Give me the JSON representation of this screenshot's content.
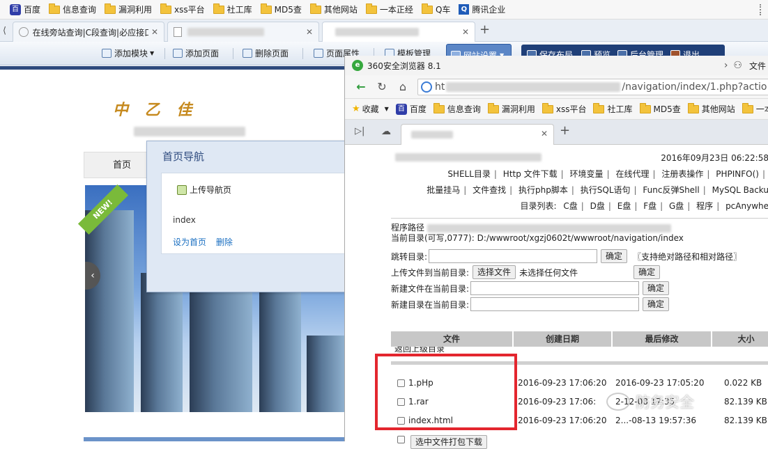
{
  "bookmarks": [
    {
      "label": "百度",
      "icon": "baidu-paw-icon"
    },
    {
      "label": "信息查询",
      "icon": "folder-icon"
    },
    {
      "label": "漏洞利用",
      "icon": "folder-icon"
    },
    {
      "label": "xss平台",
      "icon": "folder-icon"
    },
    {
      "label": "社工库",
      "icon": "folder-icon"
    },
    {
      "label": "MD5查",
      "icon": "folder-icon"
    },
    {
      "label": "其他网站",
      "icon": "folder-icon"
    },
    {
      "label": "一本正经",
      "icon": "folder-icon"
    },
    {
      "label": "Q车",
      "icon": "folder-icon"
    },
    {
      "label": "腾讯企业",
      "icon": "tencent-icon"
    }
  ],
  "outer_tabs": {
    "tab1": "在线旁站查询|C段查询|必应接口"
  },
  "toolbar": {
    "add_module": "添加模块",
    "add_page": "添加页面",
    "delete_page": "删除页面",
    "page_props": "页面属性",
    "template_mgmt": "模板管理",
    "site_settings": "网站设置",
    "save_layout": "保存布局",
    "preview": "预览",
    "backend": "后台管理",
    "logout": "退出"
  },
  "site": {
    "logo": "中 乙 佳",
    "home_menu": "首页",
    "ribbon": "NEW!",
    "prev_arrow": "‹"
  },
  "dialog": {
    "title": "首页导航",
    "upload_link": "上传导航页",
    "item": "index",
    "set_home": "设为首页",
    "delete": "删除"
  },
  "inner_browser": {
    "title": "360安全浏览器 8.1",
    "file_menu": "文件",
    "url_prefix": "ht",
    "url_suffix": "/navigation/index/1.php?actio",
    "bookmarks": [
      {
        "label": "收藏",
        "icon": "star-icon"
      },
      {
        "label": "百度",
        "icon": "baidu-paw-icon"
      },
      {
        "label": "信息查询",
        "icon": "folder-icon"
      },
      {
        "label": "漏洞利用",
        "icon": "folder-icon"
      },
      {
        "label": "xss平台",
        "icon": "folder-icon"
      },
      {
        "label": "社工库",
        "icon": "folder-icon"
      },
      {
        "label": "MD5查",
        "icon": "folder-icon"
      },
      {
        "label": "其他网站",
        "icon": "folder-icon"
      },
      {
        "label": "一本正",
        "icon": "folder-icon"
      }
    ]
  },
  "shell": {
    "datetime": "2016年09月23日 06:22:58",
    "menu1": [
      "SHELL目录",
      "Http 文件下载",
      "环境变量",
      "在线代理",
      "注册表操作",
      "PHPINFO()"
    ],
    "menu2": [
      "批量挂马",
      "文件查找",
      "执行php脚本",
      "执行SQL语句",
      "Func反弹Shell",
      "MySQL Backu"
    ],
    "drives_label": "目录列表:",
    "drives": [
      "C盘",
      "D盘",
      "E盘",
      "F盘",
      "G盘",
      "程序",
      "pcAnywhe"
    ],
    "program_path_label": "程序路径",
    "current_dir": "当前目录(可写,0777): D:/wwwroot/xgzj0602t/wwwroot/navigation/index",
    "jump_label": "跳转目录:",
    "confirm": "确定",
    "jump_hint": "〖支持绝对路径和相对路径〗",
    "upload_label": "上传文件到当前目录:",
    "choose_file": "选择文件",
    "no_file": "未选择任何文件",
    "newfile_label": "新建文件在当前目录:",
    "newdir_label": "新建目录在当前目录:",
    "table_headers": [
      "文件",
      "创建日期",
      "最后修改",
      "大小"
    ],
    "back_label": "返回上级目录",
    "files": [
      {
        "name": "1.pHp",
        "created": "2016-09-23 17:06:20",
        "modified": "2016-09-23 17:05:20",
        "size": "0.022 KB"
      },
      {
        "name": "1.rar",
        "created": "2016-09-23 17:06:",
        "modified": "2-12-08 17:35",
        "size": "82.139 KB"
      },
      {
        "name": "index.html",
        "created": "2016-09-23 17:06:20",
        "modified": "2...-08-13 19:57:36",
        "size": "82.139 KB"
      }
    ],
    "pack_download": "选中文件打包下载"
  },
  "watermark": "防务安全"
}
